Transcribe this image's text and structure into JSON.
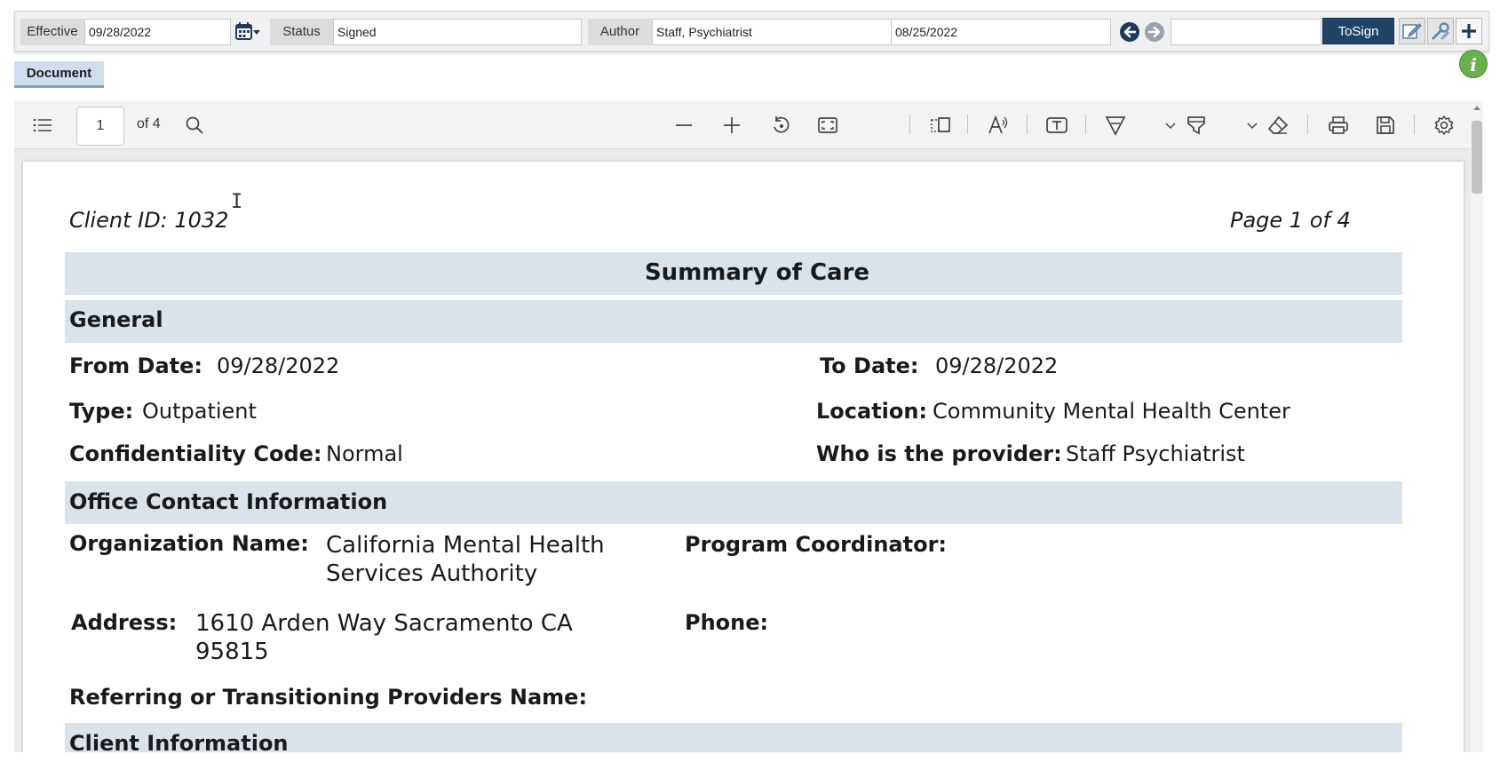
{
  "header": {
    "effective_label": "Effective",
    "effective_value": "09/28/2022",
    "status_label": "Status",
    "status_value": "Signed",
    "author_label": "Author",
    "author_value": "Staff, Psychiatrist",
    "date_value": "08/25/2022",
    "extra_value": "",
    "tosign_label": "ToSign",
    "info_label": "i"
  },
  "tabs": {
    "document_label": "Document"
  },
  "viewer": {
    "page_input": "1",
    "page_of": "of 4"
  },
  "document": {
    "client_id": "Client ID: 1032",
    "page_label": "Page 1 of 4",
    "title": "Summary of Care",
    "general": {
      "heading": "General",
      "from_date_label": "From Date:",
      "from_date_value": "09/28/2022",
      "to_date_label": "To Date:",
      "to_date_value": "09/28/2022",
      "type_label": "Type:",
      "type_value": "Outpatient",
      "location_label": "Location:",
      "location_value": "Community Mental Health Center",
      "confidentiality_label": "Confidentiality Code:",
      "confidentiality_value": "Normal",
      "provider_label": "Who is the provider:",
      "provider_value": "Staff Psychiatrist"
    },
    "office": {
      "heading": "Office Contact Information",
      "org_label": "Organization Name:",
      "org_value_line1": "California Mental Health",
      "org_value_line2": "Services Authority",
      "coordinator_label": "Program Coordinator:",
      "address_label": "Address:",
      "address_line1": "1610 Arden Way Sacramento CA",
      "address_line2": "95815",
      "phone_label": "Phone:",
      "referring_label": "Referring or Transitioning Providers Name:"
    },
    "client_info_heading": "Client Information"
  },
  "colors": {
    "tosign_bg": "#1f4468",
    "band_bg": "#dae3ea",
    "nav_circle": "#1f3a5c",
    "info_green": "#6ab04c"
  }
}
